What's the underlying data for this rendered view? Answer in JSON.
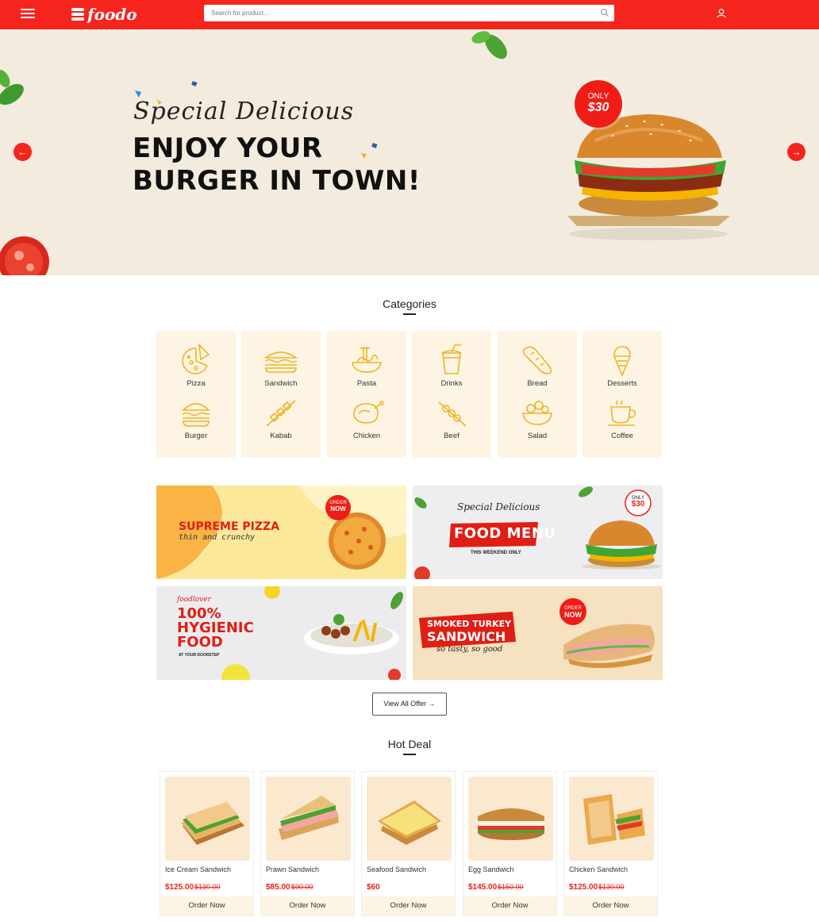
{
  "header": {
    "brand": "foodo",
    "search_placeholder": "Search for product..."
  },
  "hero": {
    "script_text": "Special Delicious",
    "headline_line1": "ENJOY YOUR",
    "headline_line2": "BURGER IN TOWN!",
    "badge_top": "ONLY",
    "badge_price": "$30",
    "prev_arrow": "←",
    "next_arrow": "→"
  },
  "categories": {
    "title": "Categories",
    "items": [
      {
        "label": "Pizza",
        "icon": "pizza-icon"
      },
      {
        "label": "Burger",
        "icon": "burger-icon"
      },
      {
        "label": "Sandwich",
        "icon": "sandwich-icon"
      },
      {
        "label": "Kabab",
        "icon": "kabab-icon"
      },
      {
        "label": "Pasta",
        "icon": "pasta-icon"
      },
      {
        "label": "Chicken",
        "icon": "chicken-icon"
      },
      {
        "label": "Drinks",
        "icon": "drinks-icon"
      },
      {
        "label": "Beef",
        "icon": "beef-icon"
      },
      {
        "label": "Bread",
        "icon": "bread-icon"
      },
      {
        "label": "Salad",
        "icon": "salad-icon"
      },
      {
        "label": "Desserts",
        "icon": "desserts-icon"
      },
      {
        "label": "Coffee",
        "icon": "coffee-icon"
      }
    ]
  },
  "promos": {
    "pizza": {
      "title": "SUPREME PIZZA",
      "subtitle": "thin and crunchy",
      "badge1": "ORDER",
      "badge2": "NOW"
    },
    "menu": {
      "script": "Special Delicious",
      "title": "FOOD MENU",
      "subtitle": "THIS WEEKEND ONLY",
      "badge1": "ONLY",
      "badge2": "$30"
    },
    "hygienic": {
      "brand": "foodlover",
      "line1": "100%",
      "line2": "HYGIENIC",
      "line3": "FOOD",
      "subtitle": "AT YOUR DOORSTEP"
    },
    "turkey": {
      "line1": "SMOKED TURKEY",
      "line2": "SANDWICH",
      "script": "so tasty, so good",
      "badge1": "ORDER",
      "badge2": "NOW"
    }
  },
  "view_all": "View All Offer →",
  "hot_deal": {
    "title": "Hot Deal",
    "order_label": "Order Now",
    "items": [
      {
        "name": "Ice Cream Sandwich",
        "price": "$125.00",
        "old_price": "$130.00"
      },
      {
        "name": "Prawn Sandwich",
        "price": "$85.00",
        "old_price": "$90.00"
      },
      {
        "name": "Seafood Sandwich",
        "price": "$60",
        "old_price": ""
      },
      {
        "name": "Egg Sandwich",
        "price": "$145.00",
        "old_price": "$150.00"
      },
      {
        "name": "Chicken Sandwich",
        "price": "$125.00",
        "old_price": "$130.00"
      }
    ]
  },
  "colors": {
    "brand_red": "#f5241c",
    "hero_bg": "#f3ebdd",
    "card_bg": "#fdf4e3",
    "icon_yellow": "#f0b323"
  }
}
